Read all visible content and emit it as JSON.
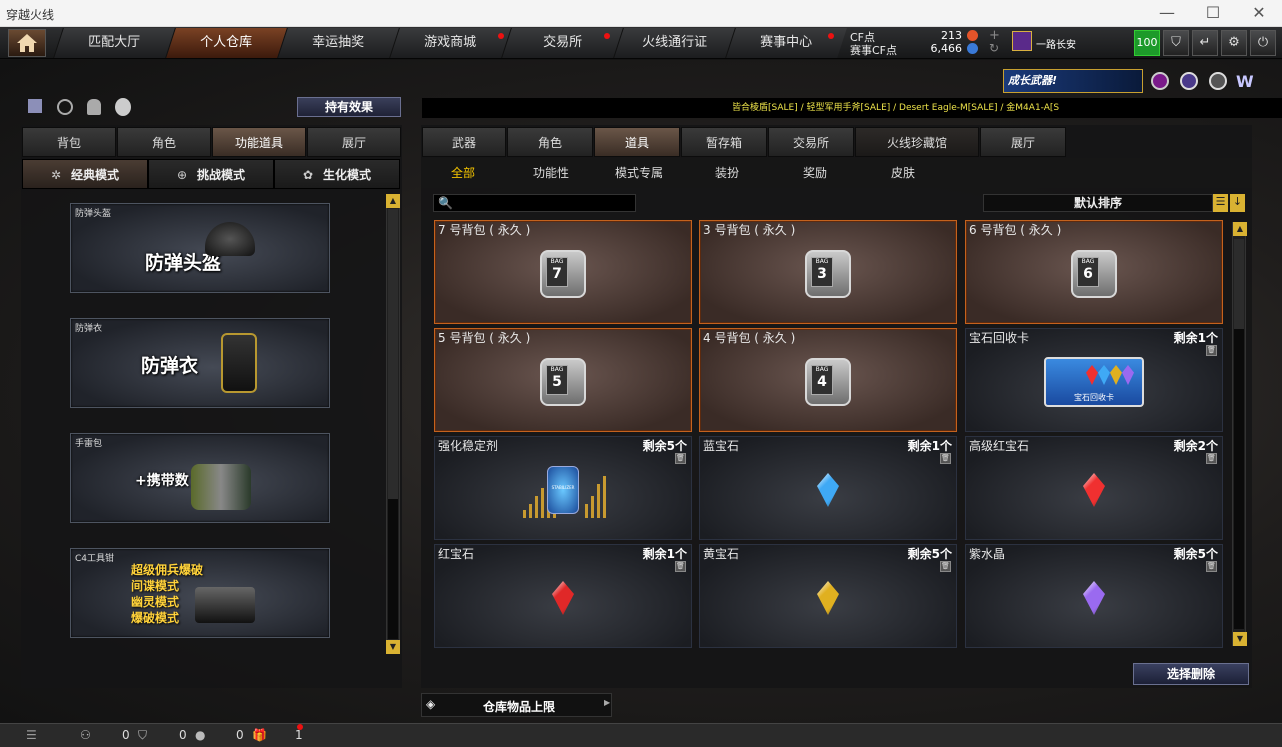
{
  "window": {
    "title": "穿越火线",
    "min": "—",
    "max": "☐",
    "close": "✕"
  },
  "nav": {
    "tabs": [
      "匹配大厅",
      "个人仓库",
      "幸运抽奖",
      "游戏商城",
      "交易所",
      "火线通行证",
      "赛事中心"
    ],
    "active": "个人仓库",
    "cf_label": "CF点",
    "cf_value": "213",
    "match_cf_label": "赛事CF点",
    "match_cf_value": "6,466",
    "player_name": "一路长安",
    "level_badge": "100"
  },
  "promo": {
    "banner": "成长武器!"
  },
  "ticker": "皆合棱盾[SALE] / 轻型军用手斧[SALE] / Desert Eagle-M[SALE] / 金M4A1-A[S",
  "left": {
    "effects_button": "持有效果",
    "tabs": [
      "背包",
      "角色",
      "功能道具",
      "展厅"
    ],
    "active_tab": "功能道具",
    "modes": [
      "经典模式",
      "挑战模式",
      "生化模式"
    ],
    "active_mode": "经典模式",
    "cards": [
      {
        "label": "防弹头盔",
        "big": "防弹头盔"
      },
      {
        "label": "防弹衣",
        "big": "防弹衣"
      },
      {
        "label": "手雷包",
        "big": "+携带数"
      },
      {
        "label": "C4工具钳",
        "lines": [
          "超级佣兵爆破",
          "间谍模式",
          "幽灵模式",
          "爆破模式"
        ]
      }
    ]
  },
  "right": {
    "tabs": [
      "武器",
      "角色",
      "道具",
      "暂存箱",
      "交易所",
      "火线珍藏馆",
      "展厅"
    ],
    "active_tab": "道具",
    "subtabs": [
      "全部",
      "功能性",
      "模式专属",
      "装扮",
      "奖励",
      "皮肤"
    ],
    "active_subtab": "全部",
    "search_placeholder": "",
    "sort_label": "默认排序",
    "items": [
      {
        "name": "7 号背包 ( 永久 )",
        "kind": "bag",
        "num": "7",
        "count": ""
      },
      {
        "name": "3 号背包 ( 永久 )",
        "kind": "bag",
        "num": "3",
        "count": ""
      },
      {
        "name": "6 号背包 ( 永久 )",
        "kind": "bag",
        "num": "6",
        "count": ""
      },
      {
        "name": "5 号背包 ( 永久 )",
        "kind": "bag",
        "num": "5",
        "count": ""
      },
      {
        "name": "4 号背包 ( 永久 )",
        "kind": "bag",
        "num": "4",
        "count": ""
      },
      {
        "name": "宝石回收卡",
        "kind": "card",
        "count": "剩余1个",
        "card_text": "宝石回收卡"
      },
      {
        "name": "强化稳定剂",
        "kind": "stabilizer",
        "count": "剩余5个",
        "can_text": "STABILIZER"
      },
      {
        "name": "蓝宝石",
        "kind": "gem",
        "color": "#3fa9f5",
        "count": "剩余1个"
      },
      {
        "name": "高级红宝石",
        "kind": "gem",
        "color": "#f03030",
        "count": "剩余2个"
      },
      {
        "name": "红宝石",
        "kind": "gem",
        "color": "#e02828",
        "count": "剩余1个"
      },
      {
        "name": "黄宝石",
        "kind": "gem",
        "color": "#e0b020",
        "count": "剩余5个"
      },
      {
        "name": "紫水晶",
        "kind": "gem",
        "color": "#9a6af0",
        "count": "剩余5个"
      }
    ],
    "bag_tag": "BAG",
    "delete_button": "选择删除",
    "capacity_label": "仓库物品上限"
  },
  "status": {
    "friends": "0",
    "shield": "0",
    "chat": "0",
    "gift": "1"
  },
  "colors": {
    "accent": "#f4c400",
    "bag_border": "#c4621e",
    "badge_green": "#1d9a2a"
  }
}
